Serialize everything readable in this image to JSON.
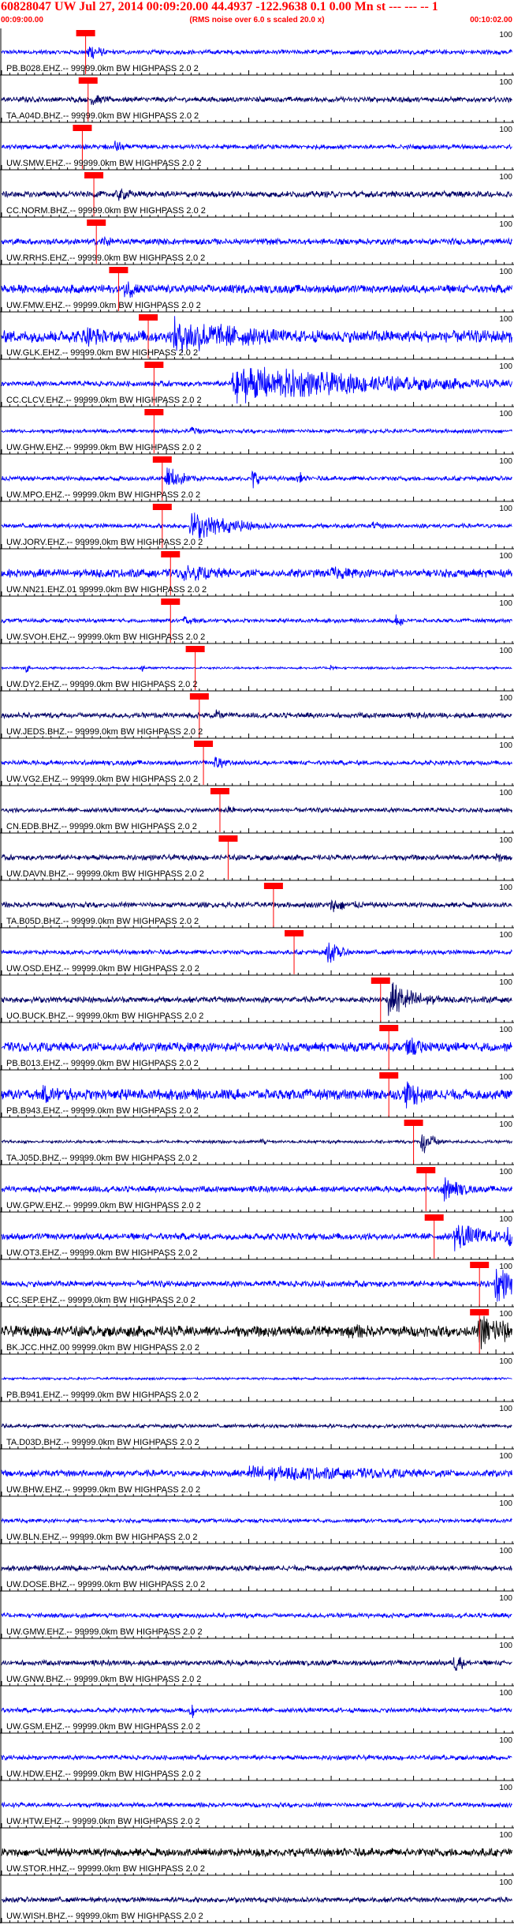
{
  "header": {
    "title": "60828047 UW Jul 27, 2014 00:09:20.00    44.4937 -122.9638  0.1 0.00 Mn st --- --- -- 1",
    "subtitle": "(RMS noise over 6.0 s scaled 20.0 x)",
    "time_start": "00:09:00.00",
    "time_end": "00:10:02.00"
  },
  "colors": {
    "trace_blue": "#0000ff",
    "trace_navy": "#000066",
    "trace_black": "#000000",
    "pick": "#ff0000",
    "title": "#ff0000"
  },
  "chart_data": {
    "type": "seismogram",
    "x_unit": "seconds after 00:09:00.00",
    "xlim": [
      0,
      62
    ],
    "tick_interval_s": 1,
    "amplitude_scale_label": "100",
    "traces": [
      {
        "label": "PB.B028.EHZ.-- 99999.0km BW  HIGHPASS  2.0  2",
        "color": "#0000ff",
        "noise": 0.3,
        "pick": 10.2,
        "bursts": [
          {
            "t": 10.6,
            "amp": 1.6,
            "dur": 1.5
          }
        ]
      },
      {
        "label": "TA.A04D.BHZ.-- 99999.0km BW  HIGHPASS  2.0  2",
        "color": "#000066",
        "noise": 0.35,
        "pick": 10.5,
        "bursts": [
          {
            "t": 11.0,
            "amp": 1.0,
            "dur": 2.0
          }
        ]
      },
      {
        "label": "UW.SMW.EHZ.-- 99999.0km BW  HIGHPASS  2.0  2",
        "color": "#0000ff",
        "noise": 0.3,
        "pick": 9.8,
        "bursts": [
          {
            "t": 13.8,
            "amp": 1.3,
            "dur": 1.0
          },
          {
            "t": 12.5,
            "amp": 0.7,
            "dur": 0.5
          }
        ]
      },
      {
        "label": "CC.NORM.BHZ.-- 99999.0km BW  HIGHPASS  2.0  2",
        "color": "#000066",
        "noise": 0.4,
        "pick": 11.2,
        "bursts": [
          {
            "t": 14.0,
            "amp": 1.0,
            "dur": 3.0
          }
        ]
      },
      {
        "label": "UW.RRHS.EHZ.-- 99999.0km BW  HIGHPASS  2.0  2",
        "color": "#0000ff",
        "noise": 0.4,
        "pick": 11.5,
        "bursts": [
          {
            "t": 12.2,
            "amp": 1.2,
            "dur": 1.2
          }
        ]
      },
      {
        "label": "UW.FMW.EHZ.-- 99999.0km BW  HIGHPASS  2.0  2",
        "color": "#0000ff",
        "noise": 0.55,
        "pick": 14.2,
        "bursts": [
          {
            "t": 15.0,
            "amp": 1.4,
            "dur": 3.0
          },
          {
            "t": 62.0,
            "amp": 1.8,
            "dur": 2.0
          }
        ]
      },
      {
        "label": "UW.GLK.EHZ.-- 99999.0km BW  HIGHPASS  2.0  2",
        "color": "#0000ff",
        "noise": 0.8,
        "pick": 17.8,
        "bursts": [
          {
            "t": 21.0,
            "amp": 2.6,
            "dur": 12.0
          },
          {
            "t": 10.0,
            "amp": 1.6,
            "dur": 4.0
          }
        ]
      },
      {
        "label": "CC.CLCV.EHZ.-- 99999.0km BW  HIGHPASS  2.0  2",
        "color": "#0000ff",
        "noise": 0.35,
        "pick": 18.5,
        "bursts": [
          {
            "t": 28.0,
            "amp": 2.7,
            "dur": 20.0
          }
        ]
      },
      {
        "label": "UW.GHW.EHZ.-- 99999.0km BW  HIGHPASS  2.0  2",
        "color": "#0000ff",
        "noise": 0.25,
        "pick": 18.5,
        "bursts": [
          {
            "t": 23.0,
            "amp": 1.0,
            "dur": 1.5
          }
        ]
      },
      {
        "label": "UW.MPO.EHZ.-- 99999.0km BW  HIGHPASS  2.0  2",
        "color": "#0000ff",
        "noise": 0.3,
        "pick": 19.5,
        "bursts": [
          {
            "t": 20.0,
            "amp": 1.8,
            "dur": 2.5
          },
          {
            "t": 30.5,
            "amp": 1.6,
            "dur": 0.8
          },
          {
            "t": 36.0,
            "amp": 1.3,
            "dur": 0.6
          }
        ]
      },
      {
        "label": "UW.JORV.EHZ.-- 99999.0km BW  HIGHPASS  2.0  2",
        "color": "#0000ff",
        "noise": 0.3,
        "pick": 19.5,
        "bursts": [
          {
            "t": 23.0,
            "amp": 2.0,
            "dur": 6.0
          },
          {
            "t": 45.0,
            "amp": 0.6,
            "dur": 3.0
          }
        ]
      },
      {
        "label": "UW.NN21.EHZ.01 99999.0km BW  HIGHPASS  2.0  2",
        "color": "#0000ff",
        "noise": 0.55,
        "pick": 20.5,
        "bursts": [
          {
            "t": 22.0,
            "amp": 1.1,
            "dur": 10.0
          },
          {
            "t": 40.0,
            "amp": 0.9,
            "dur": 8.0
          }
        ]
      },
      {
        "label": "UW.SVOH.EHZ.-- 99999.0km BW  HIGHPASS  2.0  2",
        "color": "#0000ff",
        "noise": 0.25,
        "pick": 20.5,
        "bursts": [
          {
            "t": 48.0,
            "amp": 1.3,
            "dur": 1.0
          },
          {
            "t": 22.0,
            "amp": 0.8,
            "dur": 2.0
          }
        ]
      },
      {
        "label": "UW.DY2.EHZ.-- 99999.0km BW  HIGHPASS  2.0  2",
        "color": "#0000ff",
        "noise": 0.15,
        "pick": 23.5,
        "bursts": [
          {
            "t": 3.0,
            "amp": 0.9,
            "dur": 0.4
          },
          {
            "t": 17.0,
            "amp": 0.7,
            "dur": 0.4
          },
          {
            "t": 40.0,
            "amp": 0.7,
            "dur": 0.4
          }
        ]
      },
      {
        "label": "UW.JEDS.BHZ.-- 99999.0km BW  HIGHPASS  2.0  2",
        "color": "#000066",
        "noise": 0.35,
        "pick": 24.0,
        "bursts": [
          {
            "t": 26.0,
            "amp": 0.8,
            "dur": 1.5
          }
        ]
      },
      {
        "label": "UW.VG2.EHZ.-- 99999.0km BW  HIGHPASS  2.0  2",
        "color": "#0000ff",
        "noise": 0.3,
        "pick": 24.5,
        "bursts": [
          {
            "t": 26.0,
            "amp": 1.3,
            "dur": 1.5
          }
        ]
      },
      {
        "label": "CN.EDB.BHZ.-- 99999.0km BW  HIGHPASS  2.0  2",
        "color": "#000066",
        "noise": 0.3,
        "pick": 26.5,
        "bursts": [
          {
            "t": 27.5,
            "amp": 0.6,
            "dur": 2.0
          }
        ]
      },
      {
        "label": "UW.DAVN.BHZ.-- 99999.0km BW  HIGHPASS  2.0  2",
        "color": "#000066",
        "noise": 0.35,
        "pick": 27.5,
        "bursts": [
          {
            "t": 60.0,
            "amp": 0.8,
            "dur": 2.0
          }
        ]
      },
      {
        "label": "TA.B05D.BHZ.-- 99999.0km BW  HIGHPASS  2.0  2",
        "color": "#000066",
        "noise": 0.35,
        "pick": 33.0,
        "bursts": [
          {
            "t": 40.0,
            "amp": 1.0,
            "dur": 4.0
          }
        ]
      },
      {
        "label": "UW.OSD.EHZ.-- 99999.0km BW  HIGHPASS  2.0  2",
        "color": "#0000ff",
        "noise": 0.3,
        "pick": 35.5,
        "bursts": [
          {
            "t": 39.5,
            "amp": 1.7,
            "dur": 2.0
          }
        ]
      },
      {
        "label": "UO.BUCK.BHZ.-- 99999.0km BW  HIGHPASS  2.0  2",
        "color": "#000066",
        "noise": 0.4,
        "pick": 46.0,
        "bursts": [
          {
            "t": 47.0,
            "amp": 2.5,
            "dur": 4.0
          }
        ]
      },
      {
        "label": "PB.B013.EHZ.-- 99999.0km BW  HIGHPASS  2.0  2",
        "color": "#0000ff",
        "noise": 0.6,
        "pick": 47.0,
        "bursts": [
          {
            "t": 49.0,
            "amp": 1.6,
            "dur": 3.5
          }
        ]
      },
      {
        "label": "PB.B943.EHZ.-- 99999.0km BW  HIGHPASS  2.0  2",
        "color": "#0000ff",
        "noise": 0.7,
        "pick": 47.0,
        "bursts": [
          {
            "t": 49.0,
            "amp": 2.0,
            "dur": 3.5
          },
          {
            "t": 5.0,
            "amp": 1.2,
            "dur": 8.0
          }
        ]
      },
      {
        "label": "TA.J05D.BHZ.-- 99999.0km BW  HIGHPASS  2.0  2",
        "color": "#000066",
        "noise": 0.2,
        "pick": 50.0,
        "bursts": [
          {
            "t": 51.0,
            "amp": 2.0,
            "dur": 1.5
          },
          {
            "t": 31.5,
            "amp": 0.9,
            "dur": 0.5
          }
        ]
      },
      {
        "label": "UW.GPW.EHZ.-- 99999.0km BW  HIGHPASS  2.0  2",
        "color": "#0000ff",
        "noise": 0.4,
        "pick": 51.5,
        "bursts": [
          {
            "t": 53.5,
            "amp": 1.8,
            "dur": 3.0
          }
        ]
      },
      {
        "label": "UW.OT3.EHZ.-- 99999.0km BW  HIGHPASS  2.0  2",
        "color": "#0000ff",
        "noise": 0.45,
        "pick": 52.5,
        "bursts": [
          {
            "t": 55.0,
            "amp": 2.0,
            "dur": 5.0
          },
          {
            "t": 61.0,
            "amp": 1.8,
            "dur": 2.0
          }
        ]
      },
      {
        "label": "CC.SEP.EHZ.-- 99999.0km BW  HIGHPASS  2.0  2",
        "color": "#0000ff",
        "noise": 0.4,
        "pick": 58.0,
        "bursts": [
          {
            "t": 60.0,
            "amp": 2.5,
            "dur": 4.0
          }
        ]
      },
      {
        "label": "BK.JCC.HHZ.00 99999.0km BW  HIGHPASS  2.0  2",
        "color": "#000000",
        "noise": 0.7,
        "pick": 58.0,
        "bursts": [
          {
            "t": 58.0,
            "amp": 2.6,
            "dur": 6.0
          },
          {
            "t": 42.0,
            "amp": 1.0,
            "dur": 10.0
          }
        ]
      },
      {
        "label": "PB.B941.EHZ.-- 99999.0km BW  HIGHPASS  2.0  2",
        "color": "#0000ff",
        "noise": 0.15,
        "bursts": []
      },
      {
        "label": "TA.D03D.BHZ.-- 99999.0km BW  HIGHPASS  2.0  2",
        "color": "#000066",
        "noise": 0.25,
        "bursts": []
      },
      {
        "label": "UW.BHW.EHZ.-- 99999.0km BW  HIGHPASS  2.0  2",
        "color": "#0000ff",
        "noise": 0.45,
        "bursts": [
          {
            "t": 30.0,
            "amp": 1.1,
            "dur": 30.0
          }
        ]
      },
      {
        "label": "UW.BLN.EHZ.-- 99999.0km BW  HIGHPASS  2.0  2",
        "color": "#0000ff",
        "noise": 0.25,
        "bursts": []
      },
      {
        "label": "UW.DOSE.BHZ.-- 99999.0km BW  HIGHPASS  2.0  2",
        "color": "#000066",
        "noise": 0.35,
        "bursts": []
      },
      {
        "label": "UW.GMW.EHZ.-- 99999.0km BW  HIGHPASS  2.0  2",
        "color": "#0000ff",
        "noise": 0.3,
        "bursts": []
      },
      {
        "label": "UW.GNW.BHZ.-- 99999.0km BW  HIGHPASS  2.0  2",
        "color": "#000066",
        "noise": 0.35,
        "bursts": [
          {
            "t": 55.0,
            "amp": 1.5,
            "dur": 1.5
          }
        ]
      },
      {
        "label": "UW.GSM.EHZ.-- 99999.0km BW  HIGHPASS  2.0  2",
        "color": "#0000ff",
        "noise": 0.3,
        "bursts": [
          {
            "t": 23.0,
            "amp": 1.6,
            "dur": 0.5
          }
        ]
      },
      {
        "label": "UW.HDW.EHZ.-- 99999.0km BW  HIGHPASS  2.0  2",
        "color": "#0000ff",
        "noise": 0.3,
        "bursts": []
      },
      {
        "label": "UW.HTW.EHZ.-- 99999.0km BW  HIGHPASS  2.0  2",
        "color": "#0000ff",
        "noise": 0.3,
        "bursts": []
      },
      {
        "label": "UW.STOR.HHZ.-- 99999.0km BW  HIGHPASS  2.0  2",
        "color": "#000000",
        "noise": 0.55,
        "bursts": []
      },
      {
        "label": "UW.WISH.BHZ.-- 99999.0km BW  HIGHPASS  2.0  2",
        "color": "#000066",
        "noise": 0.35,
        "bursts": []
      }
    ]
  }
}
